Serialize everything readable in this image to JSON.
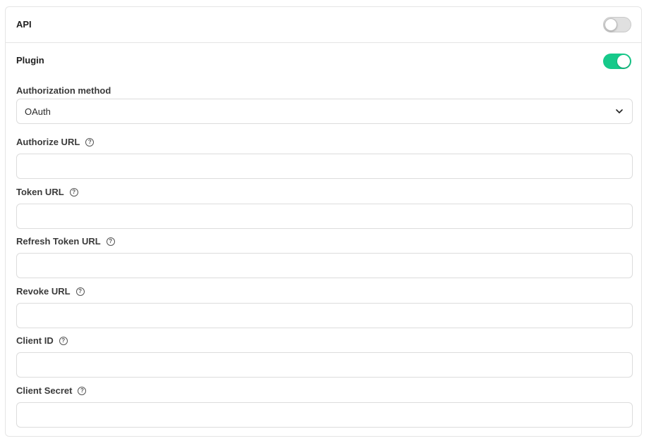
{
  "api": {
    "title": "API",
    "enabled": false
  },
  "plugin": {
    "title": "Plugin",
    "enabled": true
  },
  "authorization": {
    "label": "Authorization method",
    "selected": "OAuth"
  },
  "fields": {
    "authorize_url": {
      "label": "Authorize URL",
      "value": ""
    },
    "token_url": {
      "label": "Token URL",
      "value": ""
    },
    "refresh_token_url": {
      "label": "Refresh Token URL",
      "value": ""
    },
    "revoke_url": {
      "label": "Revoke URL",
      "value": ""
    },
    "client_id": {
      "label": "Client ID",
      "value": ""
    },
    "client_secret": {
      "label": "Client Secret",
      "value": ""
    }
  },
  "colors": {
    "toggle_on": "#17c98a",
    "toggle_off": "#e0e0e0",
    "border": "#dcdcdc"
  },
  "icons": {
    "help": "question-circle-icon",
    "dropdown": "chevron-down-icon"
  }
}
